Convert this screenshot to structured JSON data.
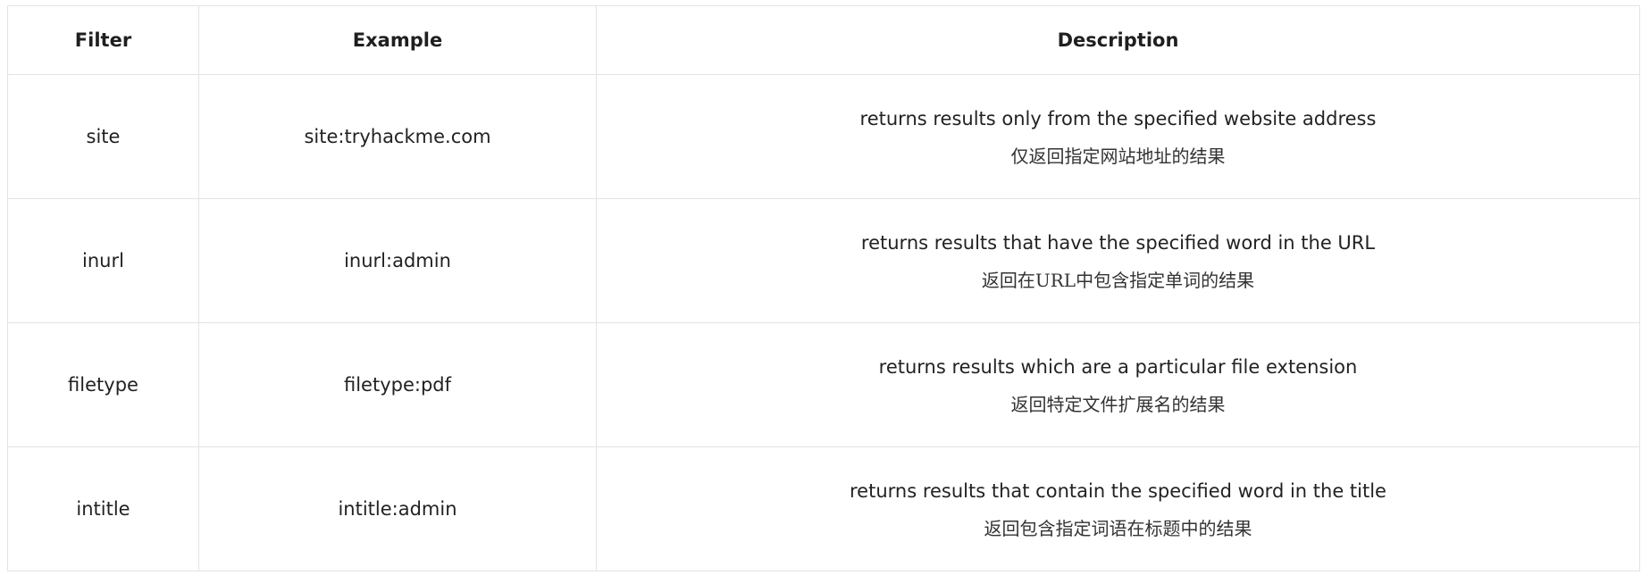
{
  "table": {
    "headers": {
      "filter": "Filter",
      "example": "Example",
      "description": "Description"
    },
    "rows": [
      {
        "filter": "site",
        "example": "site:tryhackme.com",
        "description_en": "returns results only from the specified website address",
        "description_zh": "仅返回指定网站地址的结果"
      },
      {
        "filter": "inurl",
        "example": "inurl:admin",
        "description_en": "returns results that have the specified word in the URL",
        "description_zh": "返回在URL中包含指定单词的结果"
      },
      {
        "filter": "filetype",
        "example": "filetype:pdf",
        "description_en": "returns results which are a particular file extension",
        "description_zh": "返回特定文件扩展名的结果"
      },
      {
        "filter": "intitle",
        "example": "intitle:admin",
        "description_en": "returns results that contain the specified word in the title",
        "description_zh": "返回包含指定词语在标题中的结果"
      }
    ]
  }
}
